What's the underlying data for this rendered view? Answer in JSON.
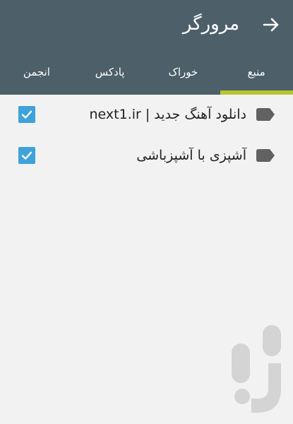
{
  "toolbar": {
    "title": "مرورگر",
    "back_icon": "arrow-right-icon"
  },
  "tabs": [
    {
      "label": "منبع",
      "active": true
    },
    {
      "label": "خوراک",
      "active": false
    },
    {
      "label": "پادکس",
      "active": false
    },
    {
      "label": "انجمن",
      "active": false
    }
  ],
  "sources": [
    {
      "label": "دانلود آهنگ جدید | next1.ir",
      "checked": true,
      "icon": "tag-icon"
    },
    {
      "label": "آشپزی با آشپزباشی",
      "checked": true,
      "icon": "tag-icon"
    }
  ],
  "colors": {
    "appbar": "#4d5f69",
    "tab_indicator": "#b7c431",
    "checkbox": "#3fa2d8",
    "background": "#f2f2f2"
  },
  "watermark": {
    "icon": "bazaar-logo-icon"
  }
}
